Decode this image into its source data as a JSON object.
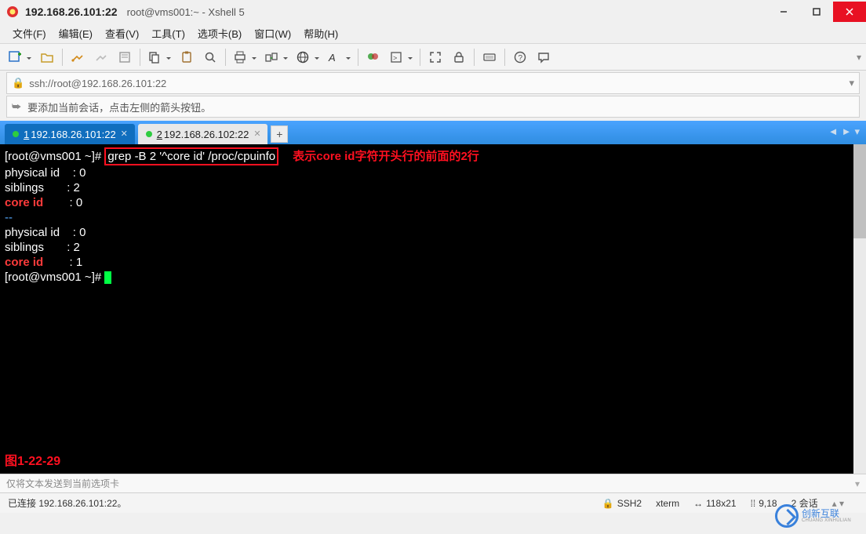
{
  "titlebar": {
    "connection": "192.168.26.101:22",
    "title": "root@vms001:~ - Xshell 5"
  },
  "menu": {
    "file": "文件(F)",
    "edit": "编辑(E)",
    "view": "查看(V)",
    "tools": "工具(T)",
    "tabs": "选项卡(B)",
    "window": "窗口(W)",
    "help": "帮助(H)"
  },
  "address": {
    "url": "ssh://root@192.168.26.101:22"
  },
  "infobar": {
    "text": "要添加当前会话，点击左侧的箭头按钮。"
  },
  "tabs": [
    {
      "num": "1",
      "label": "192.168.26.101:22",
      "active": true
    },
    {
      "num": "2",
      "label": "192.168.26.102:22",
      "active": false
    }
  ],
  "terminal": {
    "prompt1": "[root@vms001 ~]#",
    "command": "grep -B 2 '^core id' /proc/cpuinfo",
    "annotation": "表示core id字符开头行的前面的2行",
    "lines": [
      {
        "k": "physical id",
        "v": "0"
      },
      {
        "k": "siblings",
        "v": "2"
      },
      {
        "k": "core id",
        "v": "0",
        "red": true
      }
    ],
    "sep": "--",
    "lines2": [
      {
        "k": "physical id",
        "v": "0"
      },
      {
        "k": "siblings",
        "v": "2"
      },
      {
        "k": "core id",
        "v": "1",
        "red": true
      }
    ],
    "prompt2": "[root@vms001 ~]#",
    "figure_label": "图1-22-29"
  },
  "compose": {
    "placeholder": "仅将文本发送到当前选项卡"
  },
  "status": {
    "conn": "已连接 192.168.26.101:22。",
    "proto": "SSH2",
    "term": "xterm",
    "size": "118x21",
    "cursor": "9,18",
    "sessions": "2 会话"
  },
  "watermark": {
    "main": "创新互联",
    "sub": "CHUANG XINHULIAN"
  }
}
